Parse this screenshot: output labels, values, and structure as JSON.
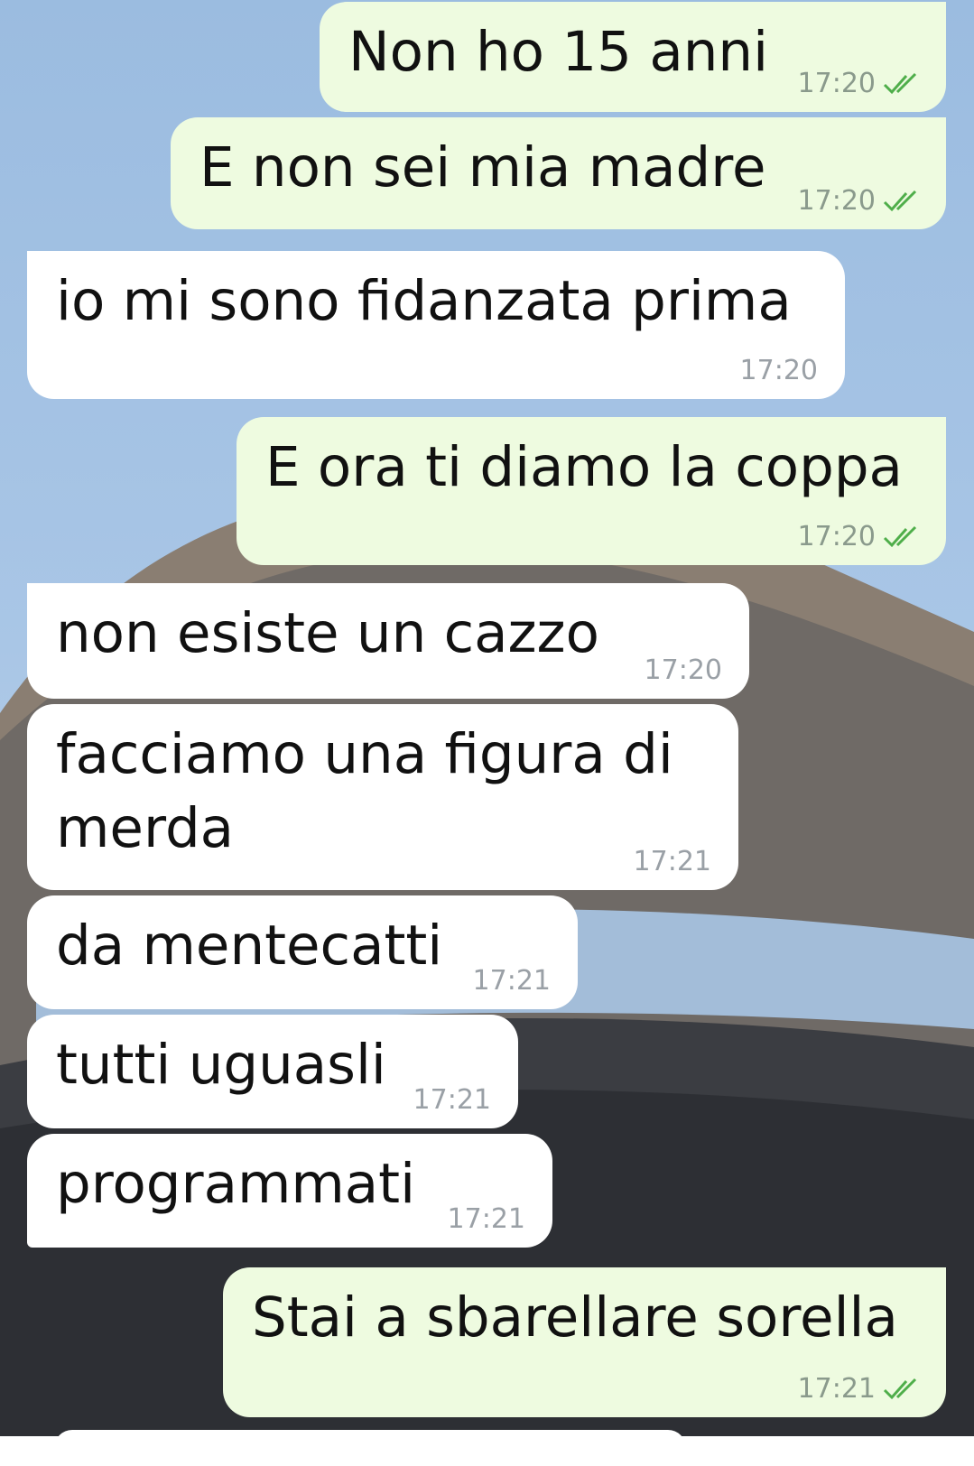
{
  "colors": {
    "outgoing_bubble": "#eefbe0",
    "incoming_bubble": "#ffffff",
    "tick_color": "#4fae4a",
    "time_color": "#8a9a8c"
  },
  "messages": [
    {
      "direction": "outgoing",
      "text": "Non ho 15 anni",
      "time": "17:20",
      "status_icon": "double-check-icon"
    },
    {
      "direction": "outgoing",
      "text": "E non sei mia madre",
      "time": "17:20",
      "status_icon": "double-check-icon"
    },
    {
      "direction": "incoming",
      "text": "io mi sono fidanzata prima",
      "time": "17:20"
    },
    {
      "direction": "outgoing",
      "text": "E ora ti diamo la coppa",
      "time": "17:20",
      "status_icon": "double-check-icon"
    },
    {
      "direction": "incoming",
      "text": "non esiste un cazzo",
      "time": "17:20"
    },
    {
      "direction": "incoming",
      "text": "facciamo una figura di merda",
      "text_lines": [
        "facciamo una figura di",
        "merda"
      ],
      "time": "17:21"
    },
    {
      "direction": "incoming",
      "text": "da mentecatti",
      "time": "17:21"
    },
    {
      "direction": "incoming",
      "text": "tutti uguasli",
      "time": "17:21"
    },
    {
      "direction": "incoming",
      "text": "programmati",
      "time": "17:21"
    },
    {
      "direction": "outgoing",
      "text": "Stai a sbarellare sorella",
      "time": "17:21",
      "status_icon": "double-check-icon"
    }
  ]
}
